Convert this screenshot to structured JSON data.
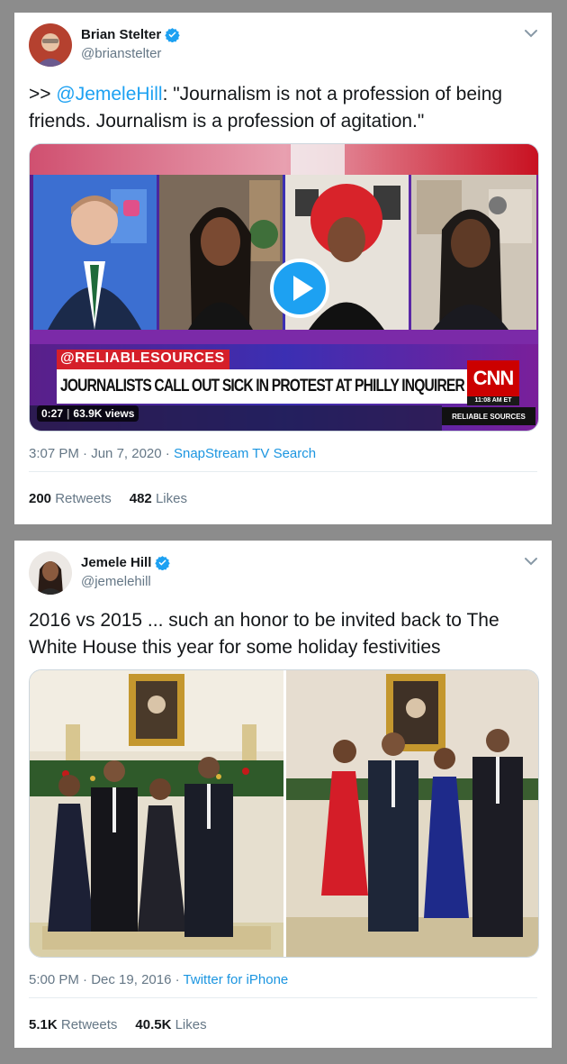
{
  "tweets": [
    {
      "name": "Brian Stelter",
      "handle": "@brianstelter",
      "text_prefix": ">> ",
      "mention": "@JemeleHill",
      "text_rest": ": \"Journalism is not a profession of being friends. Journalism is a profession of agitation.\"",
      "video": {
        "hashtag_banner": "@RELIABLESOURCES",
        "chyron": "JOURNALISTS CALL OUT SICK IN PROTEST AT PHILLY INQUIRER",
        "network": "CNN",
        "clock": "11:08 AM ET",
        "show": "RELIABLE SOURCES",
        "duration": "0:27",
        "views": "63.9K views"
      },
      "time": "3:07 PM",
      "date": "Jun 7, 2020",
      "source": "SnapStream TV Search",
      "retweets_count": "200",
      "retweets_label": "Retweets",
      "likes_count": "482",
      "likes_label": "Likes"
    },
    {
      "name": "Jemele Hill",
      "handle": "@jemelehill",
      "text": "2016 vs 2015 ... such an honor to be invited back to The White House this year for some holiday festivities",
      "time": "5:00 PM",
      "date": "Dec 19, 2016",
      "source": "Twitter for iPhone",
      "retweets_count": "5.1K",
      "retweets_label": "Retweets",
      "likes_count": "40.5K",
      "likes_label": "Likes"
    }
  ],
  "separator": "·",
  "colors": {
    "link": "#1da1f2",
    "verified": "#1da1f2",
    "cnn_red": "#cc0000",
    "chyron_purple": "#3b2fb3"
  },
  "icons": [
    "verified-badge-icon",
    "chevron-down-icon",
    "play-icon"
  ]
}
